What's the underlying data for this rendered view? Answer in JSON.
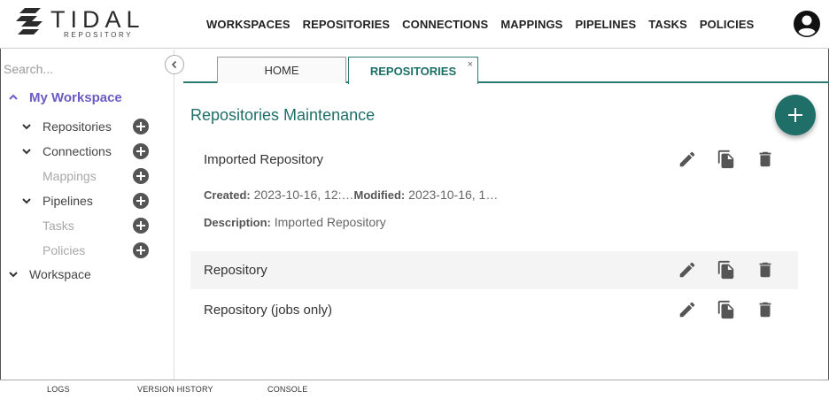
{
  "brand": {
    "name": "TIDAL",
    "sub": "REPOSITORY"
  },
  "nav": [
    "WORKSPACES",
    "REPOSITORIES",
    "CONNECTIONS",
    "MAPPINGS",
    "PIPELINES",
    "TASKS",
    "POLICIES"
  ],
  "icons": {
    "avatar": "account-circle-icon",
    "collapse": "chevron-left-icon",
    "edit": "pencil-icon",
    "copy": "copy-icon",
    "delete": "trash-icon",
    "add": "plus-icon"
  },
  "colors": {
    "accent": "#1f6f68",
    "workspace": "#6c5bc4"
  },
  "sidebar": {
    "search_placeholder": "Search...",
    "root": "My Workspace",
    "items": [
      {
        "label": "Repositories",
        "expandable": true,
        "muted": false
      },
      {
        "label": "Connections",
        "expandable": true,
        "muted": false
      },
      {
        "label": "Mappings",
        "expandable": false,
        "muted": true
      },
      {
        "label": "Pipelines",
        "expandable": true,
        "muted": false
      },
      {
        "label": "Tasks",
        "expandable": false,
        "muted": true
      },
      {
        "label": "Policies",
        "expandable": false,
        "muted": true
      }
    ],
    "workspace": "Workspace"
  },
  "tabs": {
    "home": "HOME",
    "active": "REPOSITORIES",
    "close": "×"
  },
  "main": {
    "title": "Repositories Maintenance",
    "repositories": [
      {
        "name": "Imported Repository"
      },
      {
        "name": "Repository"
      },
      {
        "name": "Repository (jobs only)"
      }
    ],
    "details": {
      "created_label": "Created:",
      "created_value": "2023-10-16, 12:…",
      "modified_label": "Modified:",
      "modified_value": "2023-10-16, 1…",
      "description_label": "Description:",
      "description_value": "Imported Repository"
    }
  },
  "footer": [
    "LOGS",
    "VERSION HISTORY",
    "CONSOLE"
  ]
}
